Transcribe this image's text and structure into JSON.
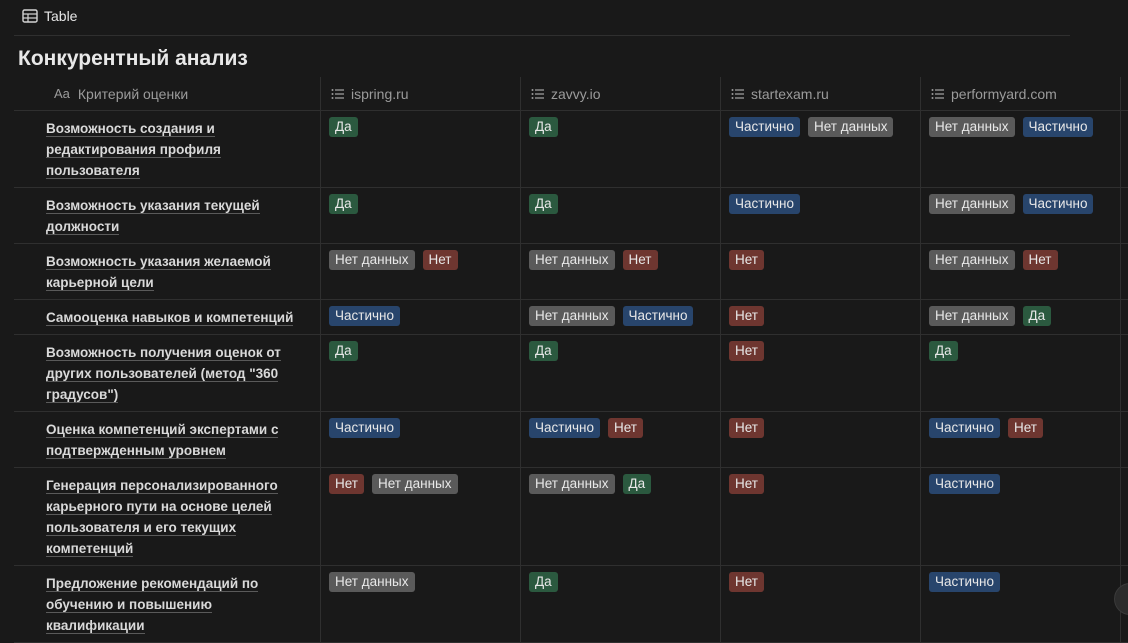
{
  "view": {
    "tab_label": "Table",
    "icon": "table-icon"
  },
  "title": "Конкурентный анализ",
  "header": {
    "criterion_prefix": "Aa",
    "criterion_label": "Критерий оценки",
    "columns": [
      "ispring.ru",
      "zavvy.io",
      "startexam.ru",
      "performyard.com"
    ]
  },
  "tag_colors": {
    "Да": "#2b593f",
    "Частично": "#28456c",
    "Нет данных": "#5a5a5a",
    "Нет": "#6e3630"
  },
  "rows": [
    {
      "criterion": [
        "Возможность создания и",
        "редактирования профиля",
        "пользователя"
      ],
      "values": [
        [
          "Да"
        ],
        [
          "Да"
        ],
        [
          "Частично",
          "Нет данных"
        ],
        [
          "Нет данных",
          "Частично"
        ]
      ]
    },
    {
      "criterion": [
        "Возможность указания текущей",
        "должности"
      ],
      "values": [
        [
          "Да"
        ],
        [
          "Да"
        ],
        [
          "Частично"
        ],
        [
          "Нет данных",
          "Частично"
        ]
      ]
    },
    {
      "criterion": [
        "Возможность указания желаемой",
        "карьерной цели"
      ],
      "values": [
        [
          "Нет данных",
          "Нет"
        ],
        [
          "Нет данных",
          "Нет"
        ],
        [
          "Нет"
        ],
        [
          "Нет данных",
          "Нет"
        ]
      ]
    },
    {
      "criterion": [
        "Самооценка навыков и компетенций"
      ],
      "values": [
        [
          "Частично"
        ],
        [
          "Нет данных",
          "Частично"
        ],
        [
          "Нет"
        ],
        [
          "Нет данных",
          "Да"
        ]
      ]
    },
    {
      "criterion": [
        "Возможность получения оценок от",
        "других пользователей (метод \"360",
        "градусов\")"
      ],
      "values": [
        [
          "Да"
        ],
        [
          "Да"
        ],
        [
          "Нет"
        ],
        [
          "Да"
        ]
      ]
    },
    {
      "criterion": [
        "Оценка компетенций экспертами с",
        "подтвержденным уровнем"
      ],
      "values": [
        [
          "Частично"
        ],
        [
          "Частично",
          "Нет"
        ],
        [
          "Нет"
        ],
        [
          "Частично",
          "Нет"
        ]
      ]
    },
    {
      "criterion": [
        "Генерация персонализированного",
        "карьерного пути на основе целей",
        "пользователя и его текущих",
        "компетенций"
      ],
      "values": [
        [
          "Нет",
          "Нет данных"
        ],
        [
          "Нет данных",
          "Да"
        ],
        [
          "Нет"
        ],
        [
          "Частично"
        ]
      ]
    },
    {
      "criterion": [
        "Предложение рекомендаций по",
        "обучению и повышению",
        "квалификации"
      ],
      "values": [
        [
          "Нет данных"
        ],
        [
          "Да"
        ],
        [
          "Нет"
        ],
        [
          "Частично"
        ]
      ]
    }
  ]
}
